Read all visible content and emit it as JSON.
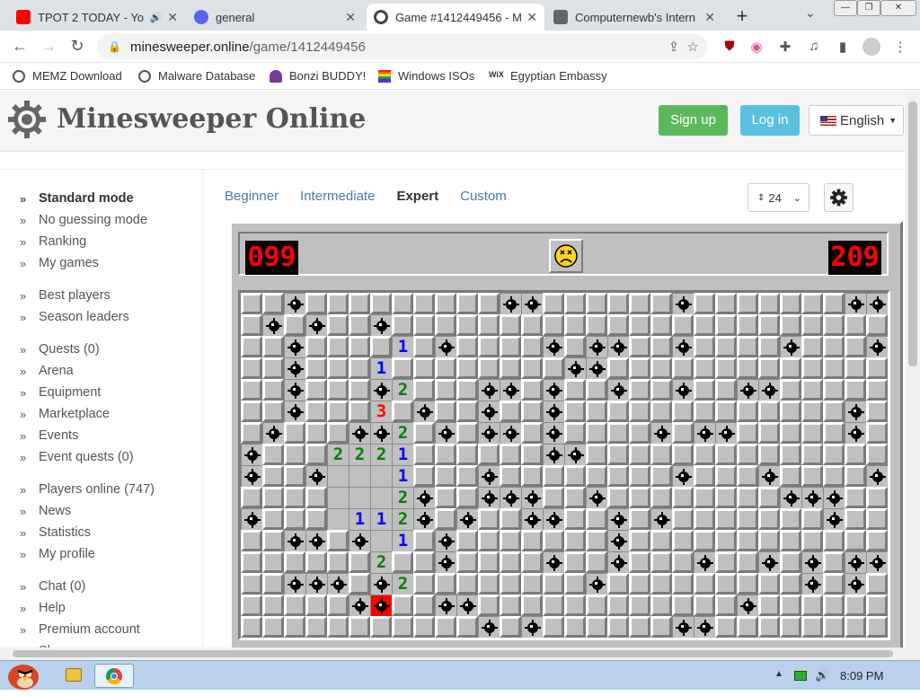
{
  "tabs": [
    {
      "title": "TPOT 2 TODAY - Yo",
      "color": "#ff0000"
    },
    {
      "title": "general",
      "color": "#5865f2"
    },
    {
      "title": "Game #1412449456 - M",
      "color": "#444444"
    },
    {
      "title": "Computernewb's Intern",
      "color": "#555555"
    }
  ],
  "address": {
    "domain": "minesweeper.online",
    "path": "/game/1412449456"
  },
  "bookmarks": [
    "MEMZ Download",
    "Malware Database",
    "Bonzi BUDDY!",
    "Windows ISOs",
    "Egyptian Embassy"
  ],
  "site": {
    "title": "Minesweeper Online",
    "signup": "Sign up",
    "login": "Log in",
    "language": "English"
  },
  "sidebar": [
    [
      "Standard mode",
      "No guessing mode",
      "Ranking",
      "My games"
    ],
    [
      "Best players",
      "Season leaders"
    ],
    [
      "Quests (0)",
      "Arena",
      "Equipment",
      "Marketplace",
      "Events",
      "Event quests (0)"
    ],
    [
      "Players online (747)",
      "News",
      "Statistics",
      "My profile"
    ],
    [
      "Chat (0)",
      "Help",
      "Premium account",
      "Shop"
    ]
  ],
  "levels": [
    "Beginner",
    "Intermediate",
    "Expert",
    "Custom"
  ],
  "zoom_select": "24",
  "game": {
    "mines_left": "099",
    "timer": "209",
    "face": "dead"
  },
  "board": [
    "CCMCCCCCCCCCMMCCCCCCMCCCCCCCMM",
    "CMCMCCMCCCCCCCCCCCCCCCCCCCCCCC",
    "CCMCCCC1CMCCCCMCMMCCMCCCCMCCCM",
    "CCMCCC1CCCCCCCCMMCCCCCCCCCCCCC",
    "CCMCCCM2CCCMMCMCCMCCMCCMMCCCCC",
    "CCMCCC3CMCCMCCMCCCCCCCCCCCCCMC",
    "CMCCCMM2CMCMMCMCCCCMCMMCCCCCMC",
    "MCCC2221CCCCCCMMCCCCCCCCCCCCCC",
    "MCCMO0O1CCCMCCCCCCCCMCCCMCCCCM",
    "CCCCOOO2MCCMMMCCMCCCCCCCCMMMCC",
    "MCCCO112MCMCCMMCCMCMCCCCCCCMCC",
    "CCMMCMO1CMCCCCCCCMCCCCCCCCCCCC",
    "CCCCCC2CCMCCCCMCCMCCCMCCMCMCMM",
    "CCMMMCM2CCCCCCCCMCCCCCCCCCMCMC",
    "CCCCCMXCCMMCCCCCCCCCCCCMCCCCCC",
    "CCCCCCCCCCCMCMCCCCCCMMCCCCCCCC"
  ],
  "taskbar": {
    "time": "8:09 PM"
  }
}
